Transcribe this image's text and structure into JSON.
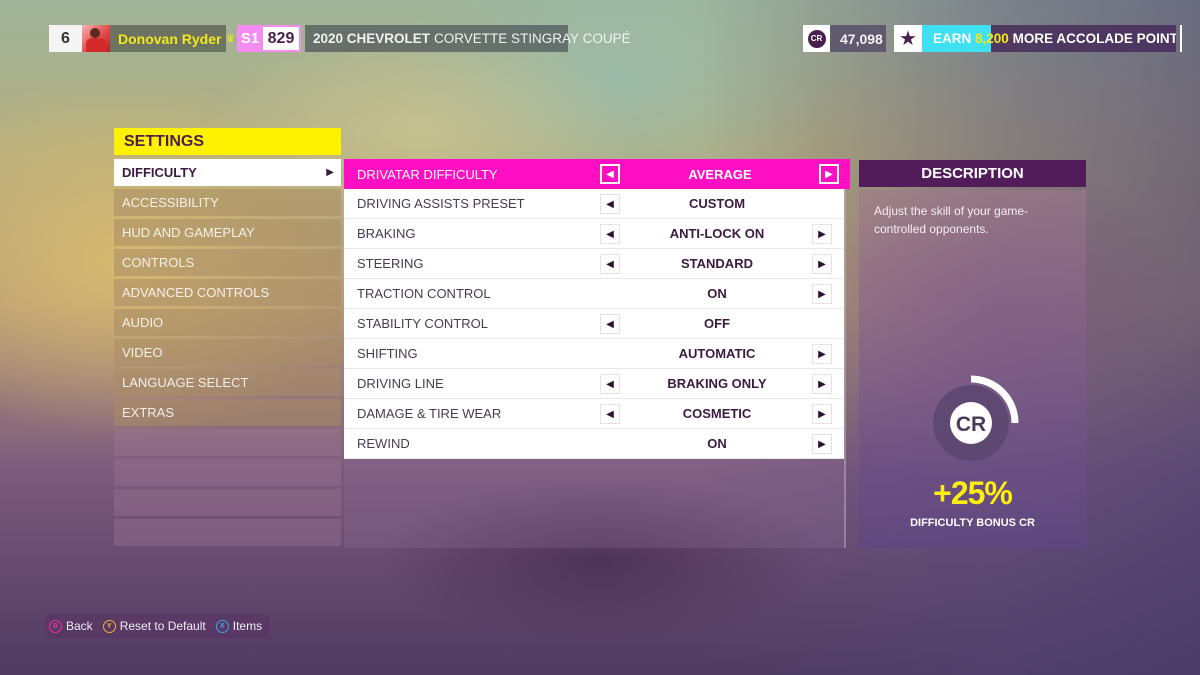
{
  "player": {
    "rank": "6",
    "name": "Donovan Ryder",
    "crown_icon": "crown-icon"
  },
  "car": {
    "class": "S1",
    "pi": "829",
    "make_year": "2020 CHEVROLET",
    "model": "CORVETTE STINGRAY COUPÉ"
  },
  "credits": {
    "icon_label": "CR",
    "value": "47,098"
  },
  "accolade": {
    "icon": "star-icon",
    "prefix": "EARN",
    "points": "8,200",
    "suffix": "MORE ACCOLADE POINTS",
    "progress_fraction": 0.27
  },
  "settings": {
    "title": "SETTINGS",
    "menu": [
      {
        "label": "DIFFICULTY",
        "active": true
      },
      {
        "label": "ACCESSIBILITY"
      },
      {
        "label": "HUD AND GAMEPLAY"
      },
      {
        "label": "CONTROLS"
      },
      {
        "label": "ADVANCED CONTROLS"
      },
      {
        "label": "AUDIO"
      },
      {
        "label": "VIDEO"
      },
      {
        "label": "LANGUAGE SELECT"
      },
      {
        "label": "EXTRAS"
      }
    ],
    "empty_slots": 4,
    "menu_arrow": "▶"
  },
  "options": [
    {
      "label": "DRIVATAR DIFFICULTY",
      "value": "AVERAGE",
      "left": true,
      "right": true,
      "active": true
    },
    {
      "label": "DRIVING ASSISTS PRESET",
      "value": "CUSTOM",
      "left": true,
      "right": false
    },
    {
      "label": "BRAKING",
      "value": "ANTI-LOCK ON",
      "left": true,
      "right": true
    },
    {
      "label": "STEERING",
      "value": "STANDARD",
      "left": true,
      "right": true
    },
    {
      "label": "TRACTION CONTROL",
      "value": "ON",
      "left": false,
      "right": true
    },
    {
      "label": "STABILITY CONTROL",
      "value": "OFF",
      "left": true,
      "right": false
    },
    {
      "label": "SHIFTING",
      "value": "AUTOMATIC",
      "left": false,
      "right": true
    },
    {
      "label": "DRIVING LINE",
      "value": "BRAKING ONLY",
      "left": true,
      "right": true
    },
    {
      "label": "DAMAGE & TIRE WEAR",
      "value": "COSMETIC",
      "left": true,
      "right": true
    },
    {
      "label": "REWIND",
      "value": "ON",
      "left": false,
      "right": true
    }
  ],
  "description": {
    "title": "DESCRIPTION",
    "text": "Adjust the skill of your game-controlled opponents.",
    "gauge_icon": "CR",
    "gauge_fraction": 0.25,
    "bonus_value": "+25%",
    "bonus_label": "DIFFICULTY BONUS CR"
  },
  "hints": [
    {
      "button": "B",
      "label": "Back",
      "color": "#e8338f"
    },
    {
      "button": "Y",
      "label": "Reset to Default",
      "color": "#e9b430"
    },
    {
      "button": "X",
      "label": "Items",
      "color": "#3aa6e6"
    }
  ],
  "colors": {
    "accent_pink": "#ff0fc3",
    "accent_yellow": "#fff200",
    "deep_purple": "#521c5a",
    "accolade_cyan": "#3fe0f2"
  }
}
